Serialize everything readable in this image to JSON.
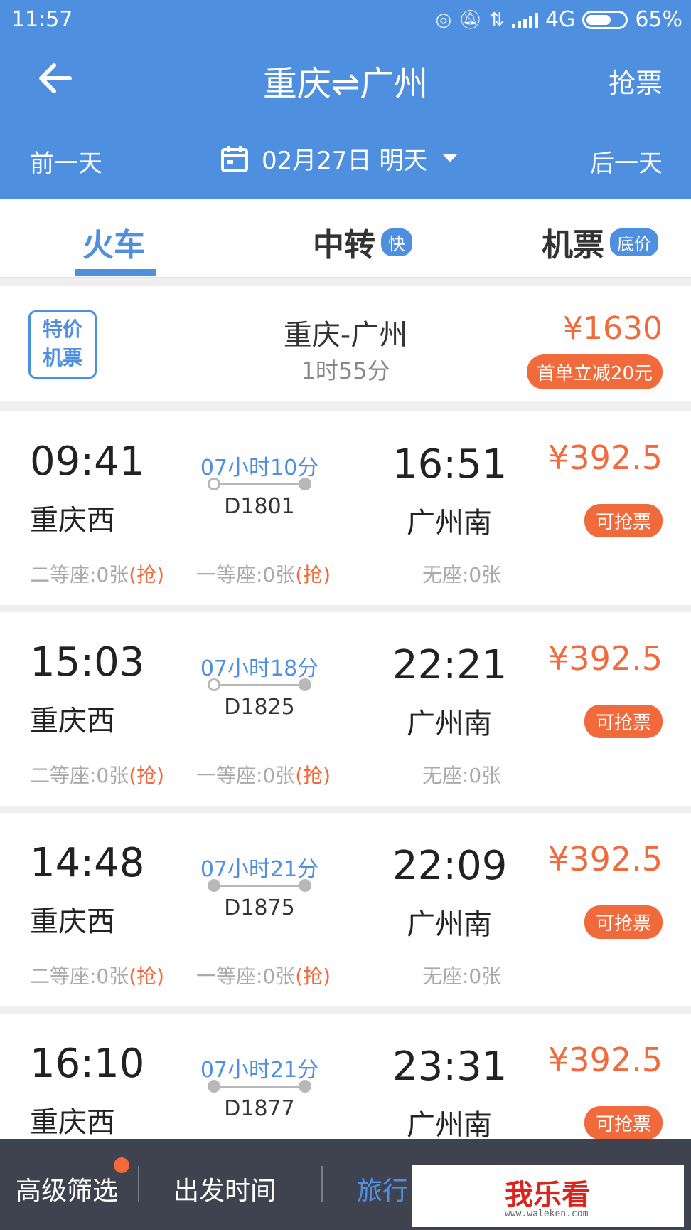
{
  "status_bar": {
    "time": "11:57",
    "network": "4G",
    "battery_pct": "65%",
    "battery_level": 0.65
  },
  "header": {
    "route_title": "重庆⇌广州",
    "grab_ticket_label": "抢票",
    "prev_day_label": "前一天",
    "next_day_label": "后一天",
    "date_label": "02月27日 明天",
    "background_color": "#4f8fe0"
  },
  "tabs": [
    {
      "label": "火车",
      "active": true
    },
    {
      "label": "中转",
      "badge": "快"
    },
    {
      "label": "机票",
      "badge": "底价"
    }
  ],
  "promo": {
    "badge_line1": "特价",
    "badge_line2": "机票",
    "route": "重庆-广州",
    "duration": "1时55分",
    "price": "¥1630",
    "discount": "首单立减20元"
  },
  "trains": [
    {
      "dep_time": "09:41",
      "dep_station": "重庆西",
      "duration": "07小时10分",
      "train_no": "D1801",
      "arr_time": "16:51",
      "arr_station": "广州南",
      "price": "¥392.5",
      "tag": "可抢票",
      "seat1": "二等座:0张",
      "seat1_grab": "(抢)",
      "seat2": "一等座:0张",
      "seat2_grab": "(抢)",
      "seat3": "无座:0张"
    },
    {
      "dep_time": "15:03",
      "dep_station": "重庆西",
      "duration": "07小时18分",
      "train_no": "D1825",
      "arr_time": "22:21",
      "arr_station": "广州南",
      "price": "¥392.5",
      "tag": "可抢票",
      "seat1": "二等座:0张",
      "seat1_grab": "(抢)",
      "seat2": "一等座:0张",
      "seat2_grab": "(抢)",
      "seat3": "无座:0张"
    },
    {
      "dep_time": "14:48",
      "dep_station": "重庆西",
      "duration": "07小时21分",
      "train_no": "D1875",
      "arr_time": "22:09",
      "arr_station": "广州南",
      "price": "¥392.5",
      "tag": "可抢票",
      "seat1": "二等座:0张",
      "seat1_grab": "(抢)",
      "seat2": "一等座:0张",
      "seat2_grab": "(抢)",
      "seat3": "无座:0张"
    },
    {
      "dep_time": "16:10",
      "dep_station": "重庆西",
      "duration": "07小时21分",
      "train_no": "D1877",
      "arr_time": "23:31",
      "arr_station": "广州南",
      "price": "¥392.5",
      "tag": "可抢票"
    }
  ],
  "bottom_bar": {
    "filter_label": "高级筛选",
    "depart_time_label": "出发时间",
    "travel_label": "旅行"
  },
  "watermark": {
    "text": "我乐看",
    "sub": "www.waleken.com"
  }
}
